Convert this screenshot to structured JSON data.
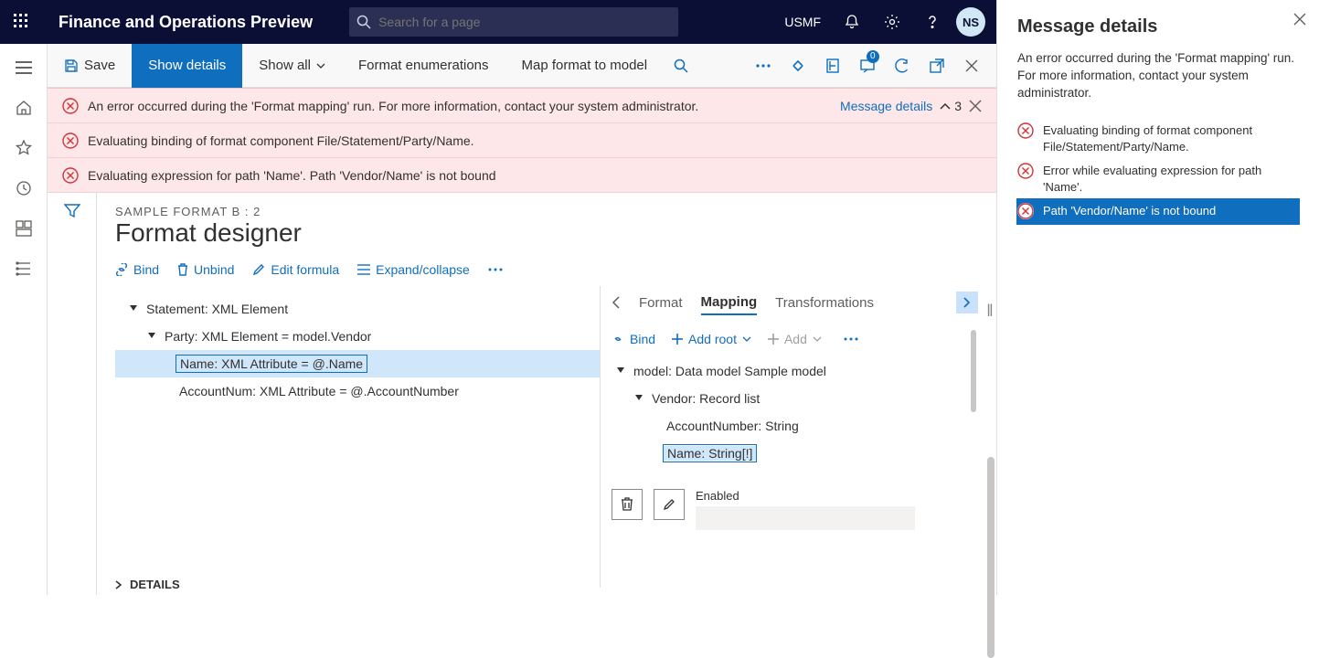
{
  "topbar": {
    "app_title": "Finance and Operations Preview",
    "search_placeholder": "Search for a page",
    "entity": "USMF",
    "avatar_initials": "NS"
  },
  "actionbar": {
    "save": "Save",
    "show_details": "Show details",
    "show_all": "Show all",
    "format_enumerations": "Format enumerations",
    "map_format": "Map format to model",
    "badge_count": "0"
  },
  "message_strip": {
    "row1": "An error occurred during the 'Format mapping' run. For more information, contact your system administrator.",
    "row2": "Evaluating binding of format component File/Statement/Party/Name.",
    "row3": "Evaluating expression for path 'Name'.   Path 'Vendor/Name' is not bound",
    "link_label": "Message details",
    "count": "3"
  },
  "designer": {
    "breadcrumb": "SAMPLE FORMAT B : 2",
    "title": "Format designer",
    "tb": {
      "bind": "Bind",
      "unbind": "Unbind",
      "edit_formula": "Edit formula",
      "expand": "Expand/collapse"
    },
    "tree": {
      "n1": "Statement: XML Element",
      "n2": "Party: XML Element = model.Vendor",
      "n3": "Name: XML Attribute = @.Name",
      "n4": "AccountNum: XML Attribute = @.AccountNumber"
    },
    "right_tabs": {
      "format": "Format",
      "mapping": "Mapping",
      "transform": "Transformations"
    },
    "right_tb": {
      "bind": "Bind",
      "add_root": "Add root",
      "add": "Add"
    },
    "right_tree": {
      "n1": "model: Data model Sample model",
      "n2": "Vendor: Record list",
      "n3": "AccountNumber: String",
      "n4": "Name: String[!]"
    },
    "enabled_label": "Enabled",
    "details": "DETAILS"
  },
  "msgpane": {
    "title": "Message details",
    "lead": "An error occurred during the 'Format mapping' run. For more information, contact your system administrator.",
    "d1": "Evaluating binding of format component File/Statement/Party/Name.",
    "d2": "Error while evaluating expression for path 'Name'.",
    "d3": "Path 'Vendor/Name' is not bound"
  }
}
